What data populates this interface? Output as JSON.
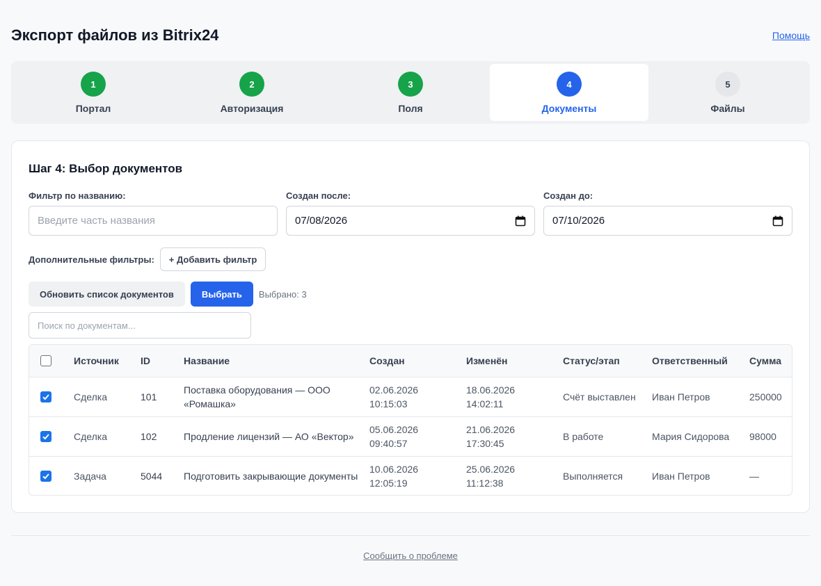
{
  "header": {
    "title": "Экспорт файлов из Bitrix24",
    "help": "Помощь"
  },
  "steps": [
    {
      "number": "1",
      "label": "Портал",
      "state": "done"
    },
    {
      "number": "2",
      "label": "Авторизация",
      "state": "done"
    },
    {
      "number": "3",
      "label": "Поля",
      "state": "done"
    },
    {
      "number": "4",
      "label": "Документы",
      "state": "active"
    },
    {
      "number": "5",
      "label": "Файлы",
      "state": "pending"
    }
  ],
  "card": {
    "title": "Шаг 4: Выбор документов"
  },
  "filters": {
    "name_label": "Фильтр по названию:",
    "name_placeholder": "Введите часть названия",
    "after_label": "Создан после:",
    "after_value": "07/08/2026",
    "before_label": "Создан до:",
    "before_value": "07/10/2026",
    "extra_label": "Дополнительные фильтры:",
    "add_filter": "+ Добавить фильтр"
  },
  "actions": {
    "refresh": "Обновить список документов",
    "select": "Выбрать",
    "selected_count": "Выбрано: 3"
  },
  "search": {
    "placeholder": "Поиск по документам..."
  },
  "table": {
    "headers": [
      "Источник",
      "ID",
      "Название",
      "Создан",
      "Изменён",
      "Статус/этап",
      "Ответственный",
      "Сумма"
    ],
    "rows": [
      {
        "checked": true,
        "source": "Сделка",
        "id": "101",
        "name": "Поставка оборудования — ООО «Ромашка»",
        "created": "02.06.2026 10:15:03",
        "modified": "18.06.2026 14:02:11",
        "status": "Счёт выставлен",
        "owner": "Иван Петров",
        "sum": "250000"
      },
      {
        "checked": true,
        "source": "Сделка",
        "id": "102",
        "name": "Продление лицензий — АО «Вектор»",
        "created": "05.06.2026 09:40:57",
        "modified": "21.06.2026 17:30:45",
        "status": "В работе",
        "owner": "Мария Сидорова",
        "sum": "98000"
      },
      {
        "checked": true,
        "source": "Задача",
        "id": "5044",
        "name": "Подготовить закрывающие документы",
        "created": "10.06.2026 12:05:19",
        "modified": "25.06.2026 11:12:38",
        "status": "Выполняется",
        "owner": "Иван Петров",
        "sum": "—"
      }
    ]
  },
  "footer": {
    "report": "Сообщить о проблеме"
  },
  "colors": {
    "primary": "#2563eb",
    "done": "#16a34a",
    "checkbox": "#1a73e8"
  }
}
